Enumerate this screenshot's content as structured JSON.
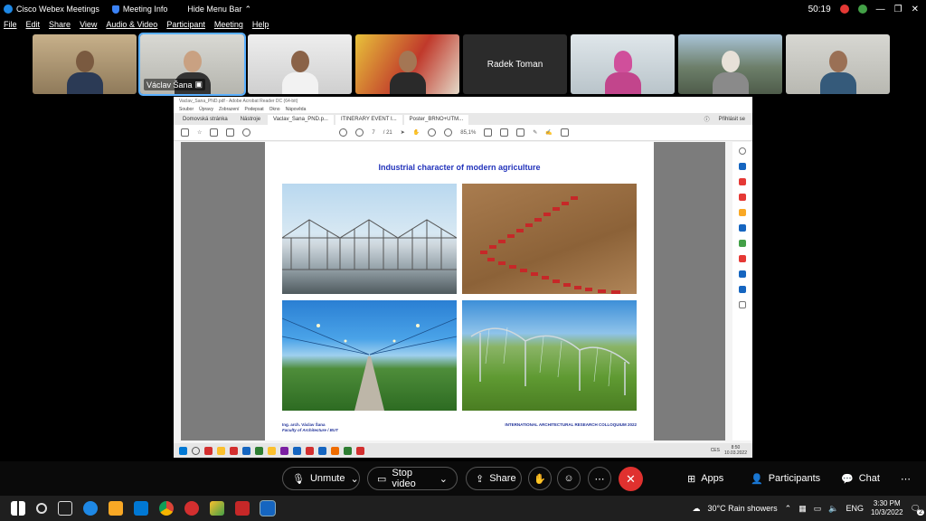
{
  "titlebar": {
    "app_name": "Cisco Webex Meetings",
    "meeting_info": "Meeting Info",
    "hide_menu_bar": "Hide Menu Bar",
    "timer": "50:19"
  },
  "menu": [
    "File",
    "Edit",
    "Share",
    "View",
    "Audio & Video",
    "Participant",
    "Meeting",
    "Help"
  ],
  "participants": [
    {
      "name": ""
    },
    {
      "name": "Václav Šana",
      "selected": true
    },
    {
      "name": ""
    },
    {
      "name": ""
    },
    {
      "name": "Radek Toman",
      "camera_off": true
    },
    {
      "name": ""
    },
    {
      "name": ""
    },
    {
      "name": ""
    }
  ],
  "acrobat": {
    "window_title": "Vaclav_Sana_PND.pdf - Adobe Acrobat Reader DC (64-bit)",
    "menu": [
      "Soubor",
      "Úpravy",
      "Zobrazení",
      "Podepsat",
      "Okno",
      "Nápověda"
    ],
    "tabs": [
      "Domovská stránka",
      "Nástroje",
      "Vaclav_Sana_PND.p...",
      "ITINERARY EVENT I...",
      "Poster_BRNO+UTM..."
    ],
    "sign_in": "Přihlásit se",
    "page_current": "7",
    "page_total": "/ 21",
    "zoom": "85,1%"
  },
  "slide": {
    "title": "Industrial character of modern agriculture",
    "author": "Ing. arch. Václav Šana",
    "faculty": "Faculty of Architecture / BUT",
    "event": "INTERNATIONAL ARCHITECTURAL RESEARCH COLLOQUIUM 2022"
  },
  "inner_taskbar": {
    "lang": "CES",
    "time": "8:50",
    "date": "10.03.2022"
  },
  "controls": {
    "unmute": "Unmute",
    "stop_video": "Stop video",
    "share": "Share",
    "apps": "Apps",
    "participants": "Participants",
    "chat": "Chat"
  },
  "taskbar": {
    "weather": "30°C  Rain showers",
    "lang": "ENG",
    "time": "3:30 PM",
    "date": "10/3/2022",
    "notifications": "2"
  },
  "colors": {
    "accent": "#1e88e5",
    "end_call": "#e0312f",
    "slide_title": "#2233bb"
  }
}
